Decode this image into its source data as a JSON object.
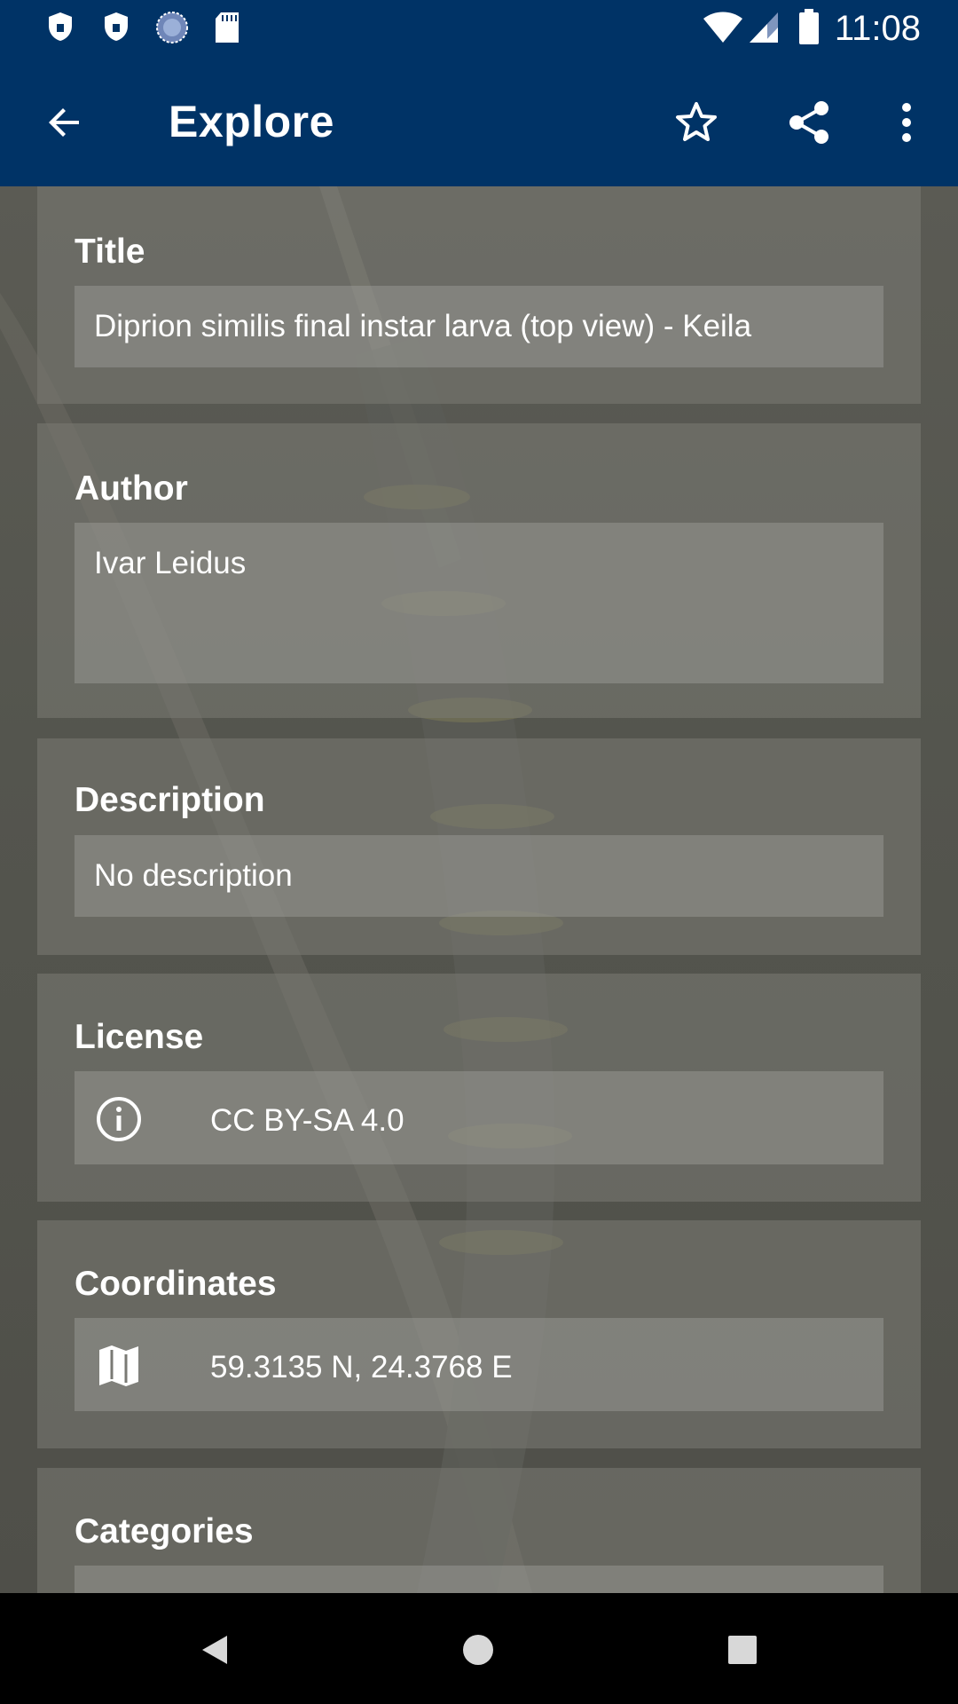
{
  "status_bar": {
    "time": "11:08",
    "icons": [
      "shield-icon",
      "shield-icon",
      "sync-icon",
      "sd-card-icon",
      "wifi-icon",
      "signal-icon",
      "battery-icon"
    ]
  },
  "app_bar": {
    "title": "Explore",
    "icons": [
      "back-arrow-icon",
      "star-outline-icon",
      "share-icon",
      "more-vert-icon"
    ]
  },
  "sections": {
    "title": {
      "label": "Title",
      "value": "Diprion similis final instar larva (top view) - Keila"
    },
    "author": {
      "label": "Author",
      "value": "Ivar Leidus"
    },
    "description": {
      "label": "Description",
      "value": "No description"
    },
    "license": {
      "label": "License",
      "value": "CC BY-SA 4.0",
      "icon": "info-icon"
    },
    "coordinates": {
      "label": "Coordinates",
      "value": "59.3135 N, 24.3768 E",
      "icon": "map-icon"
    },
    "categories": {
      "label": "Categories"
    }
  },
  "nav_bar": {
    "icons": [
      "back-triangle-icon",
      "home-circle-icon",
      "recents-square-icon"
    ]
  },
  "colors": {
    "primary": "#003366",
    "card": "#787872",
    "text": "#ffffff"
  }
}
